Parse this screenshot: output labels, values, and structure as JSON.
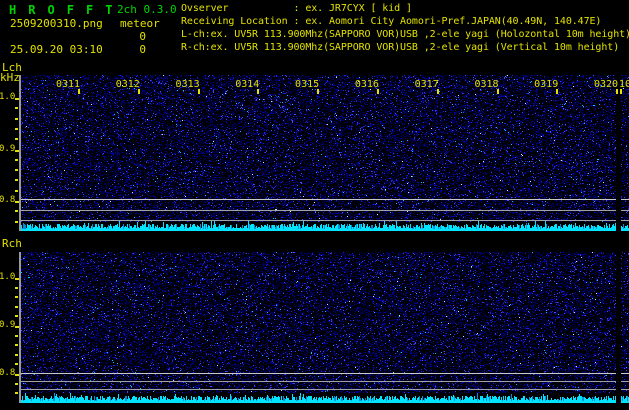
{
  "header": {
    "app_title": "H R O F F T",
    "version": "2ch 0.3.0",
    "filename": "2509200310.png",
    "mode_label": "meteor",
    "count_left": "0",
    "count_right": "0",
    "timestamp": "25.09.20 03:10",
    "observer_line": "Ovserver           : ex. JR7CYX [ kid ]",
    "location_line": "Receiving Location : ex. Aomori City Aomori-Pref.JAPAN(40.49N, 140.47E)",
    "lch_config_line": "L-ch:ex. UV5R 113.900Mhz(SAPPORO VOR)USB ,2-ele yagi (Holozontal 10m height)",
    "rch_config_line": "R-ch:ex. UV5R 113.900Mhz(SAPPORO VOR)USB ,2-ele yagi (Vertical 10m height)"
  },
  "time_axis": {
    "labels": [
      "0311",
      "0312",
      "0313",
      "0314",
      "0315",
      "0316",
      "0317",
      "0318",
      "0319",
      "0320"
    ],
    "partial_label": "10"
  },
  "panels": {
    "lch": {
      "name": "Lch",
      "unit": "kHz",
      "yticks": [
        "1.0",
        "0.9",
        "0.8"
      ]
    },
    "rch": {
      "name": "Rch",
      "yticks": [
        "1.0",
        "0.9",
        "0.8"
      ]
    }
  },
  "colors": {
    "title_green": "#00d400",
    "text_yellow": "#e2e200",
    "signal_cyan": "#00e4ff",
    "carrier_line_bright": "#c8c8c8",
    "carrier_line": "#a2a2a2",
    "axis_gray": "#9a9a9a",
    "noise_blue_dim": "#000052",
    "noise_blue": "#0000a0",
    "noise_blue_bright": "#2222cc"
  }
}
